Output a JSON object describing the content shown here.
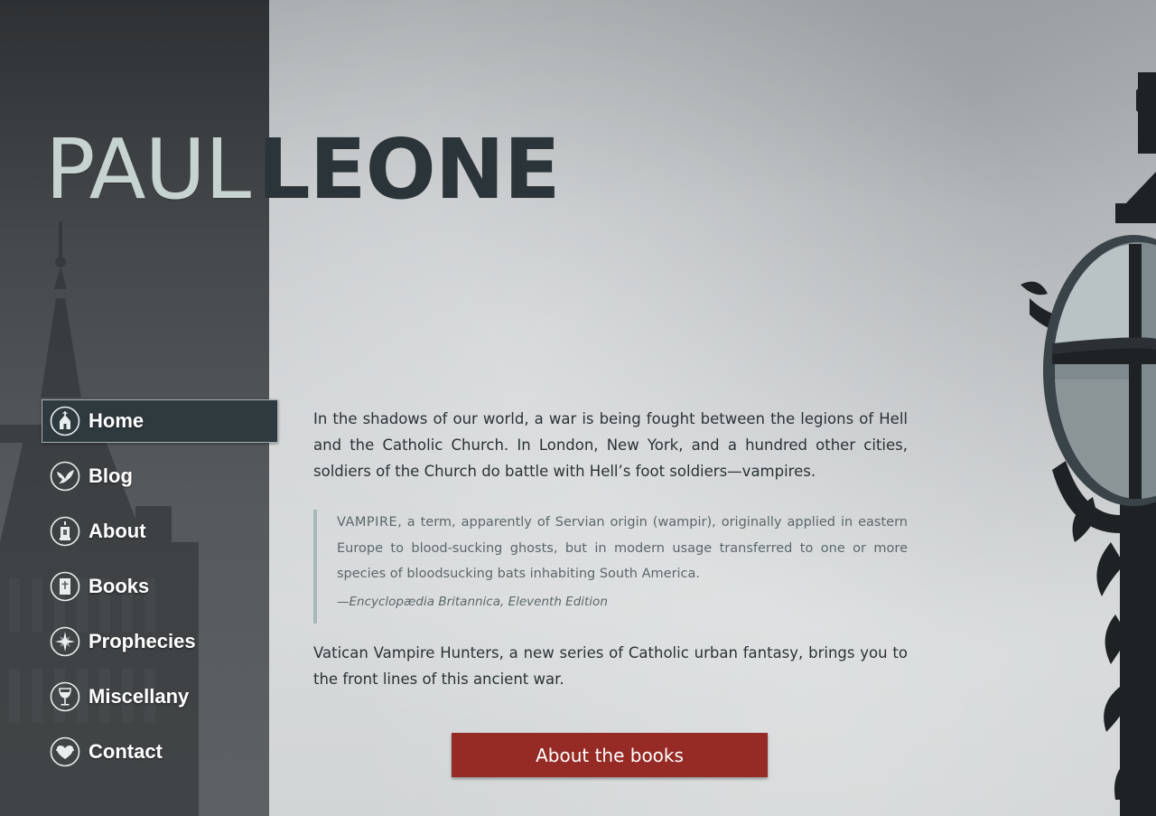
{
  "site_title": {
    "first": "PAUL",
    "last": "LEONE"
  },
  "nav": {
    "items": [
      {
        "label": "Home",
        "icon": "church-icon",
        "active": true
      },
      {
        "label": "Blog",
        "icon": "dove-icon",
        "active": false
      },
      {
        "label": "About",
        "icon": "lantern-icon",
        "active": false
      },
      {
        "label": "Books",
        "icon": "book-icon",
        "active": false
      },
      {
        "label": "Prophecies",
        "icon": "star-compass-icon",
        "active": false
      },
      {
        "label": "Miscellany",
        "icon": "wine-glass-icon",
        "active": false
      },
      {
        "label": "Contact",
        "icon": "heart-icon",
        "active": false
      }
    ]
  },
  "content": {
    "intro": "In the shadows of our world, a war is being fought between the legions of Hell and the Catholic Church. In London, New York, and a hundred other cities, soldiers of the Church do battle with Hell’s foot soldiers—vampires.",
    "quote": {
      "term": "VAMPIRE",
      "text": ", a term, apparently of Servian origin (wampir), originally applied in eastern Europe to blood-sucking ghosts, but in modern usage transferred to one or more species of bloodsucking bats inhabiting South America.",
      "cite": "—Encyclopædia Britannica, Eleventh Edition"
    },
    "outro": "Vatican Vampire Hunters, a new series of Catholic urban fantasy, brings you to the front lines of this ancient war.",
    "cta_label": "About the books"
  },
  "colors": {
    "accent_red": "#962a25",
    "title_dark": "#2b3539",
    "title_light": "#c7d3d0",
    "nav_active_bg": "#2f3a3f",
    "quote_border": "#a8b8b8"
  }
}
